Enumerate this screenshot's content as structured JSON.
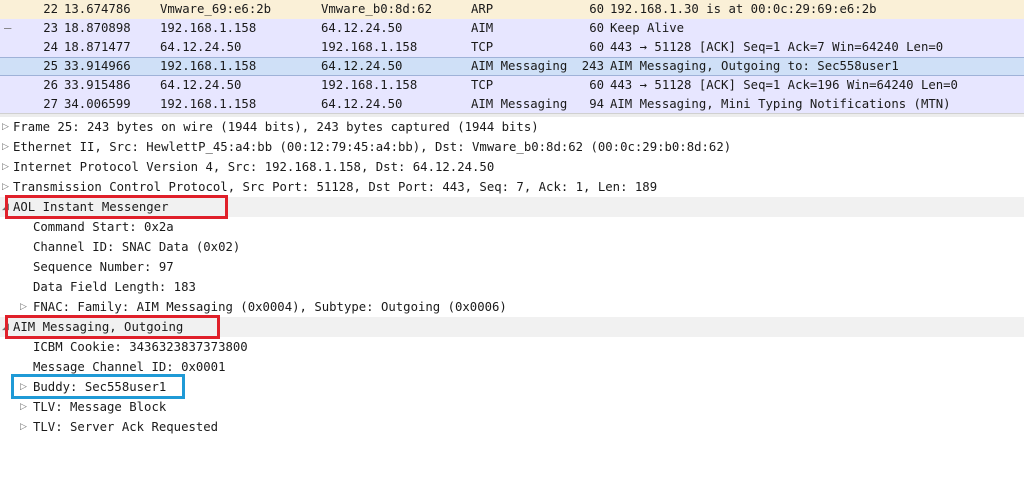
{
  "colors": {
    "arp_row": "#faf0d7",
    "tcp_row": "#e7e6ff",
    "selected_row": "#cfe0f7",
    "highlight_red": "#e0202a",
    "highlight_blue": "#1f9ad6"
  },
  "packets": [
    {
      "no": "22",
      "time": "13.674786",
      "src": "Vmware_69:e6:2b",
      "dst": "Vmware_b0:8d:62",
      "proto": "ARP",
      "len": "60",
      "info": "192.168.1.30 is at 00:0c:29:69:e6:2b",
      "mark": ""
    },
    {
      "no": "23",
      "time": "18.870898",
      "src": "192.168.1.158",
      "dst": "64.12.24.50",
      "proto": "AIM",
      "len": "60",
      "info": "Keep Alive",
      "mark": "—"
    },
    {
      "no": "24",
      "time": "18.871477",
      "src": "64.12.24.50",
      "dst": "192.168.1.158",
      "proto": "TCP",
      "len": "60",
      "info": "443 → 51128 [ACK] Seq=1 Ack=7 Win=64240 Len=0",
      "mark": ""
    },
    {
      "no": "25",
      "time": "33.914966",
      "src": "192.168.1.158",
      "dst": "64.12.24.50",
      "proto": "AIM Messaging",
      "len": "243",
      "info": "AIM Messaging, Outgoing to: Sec558user1",
      "mark": ""
    },
    {
      "no": "26",
      "time": "33.915486",
      "src": "64.12.24.50",
      "dst": "192.168.1.158",
      "proto": "TCP",
      "len": "60",
      "info": "443 → 51128 [ACK] Seq=1 Ack=196 Win=64240 Len=0",
      "mark": ""
    },
    {
      "no": "27",
      "time": "34.006599",
      "src": "192.168.1.158",
      "dst": "64.12.24.50",
      "proto": "AIM Messaging",
      "len": "94",
      "info": "AIM Messaging, Mini Typing Notifications (MTN)",
      "mark": ""
    }
  ],
  "details": {
    "frame": "Frame 25: 243 bytes on wire (1944 bits), 243 bytes captured (1944 bits)",
    "ethernet": "Ethernet II, Src: HewlettP_45:a4:bb (00:12:79:45:a4:bb), Dst: Vmware_b0:8d:62 (00:0c:29:b0:8d:62)",
    "ip": "Internet Protocol Version 4, Src: 192.168.1.158, Dst: 64.12.24.50",
    "tcp": "Transmission Control Protocol, Src Port: 51128, Dst Port: 443, Seq: 7, Ack: 1, Len: 189",
    "aol": "AOL Instant Messenger",
    "command_start": "Command Start: 0x2a",
    "channel_id": "Channel ID: SNAC Data (0x02)",
    "sequence_number": "Sequence Number: 97",
    "data_field_length": "Data Field Length: 183",
    "fnac": "FNAC: Family: AIM Messaging (0x0004), Subtype: Outgoing (0x0006)",
    "aim_outgoing": "AIM Messaging, Outgoing",
    "icbm_cookie": "ICBM Cookie: 3436323837373800",
    "message_channel": "Message Channel ID: 0x0001",
    "buddy": "Buddy: Sec558user1",
    "tlv_message_block": "TLV: Message Block",
    "tlv_server_ack": "TLV: Server Ack Requested"
  },
  "icons": {
    "expand_arrow": "▷",
    "collapse_arrow": "◢"
  }
}
